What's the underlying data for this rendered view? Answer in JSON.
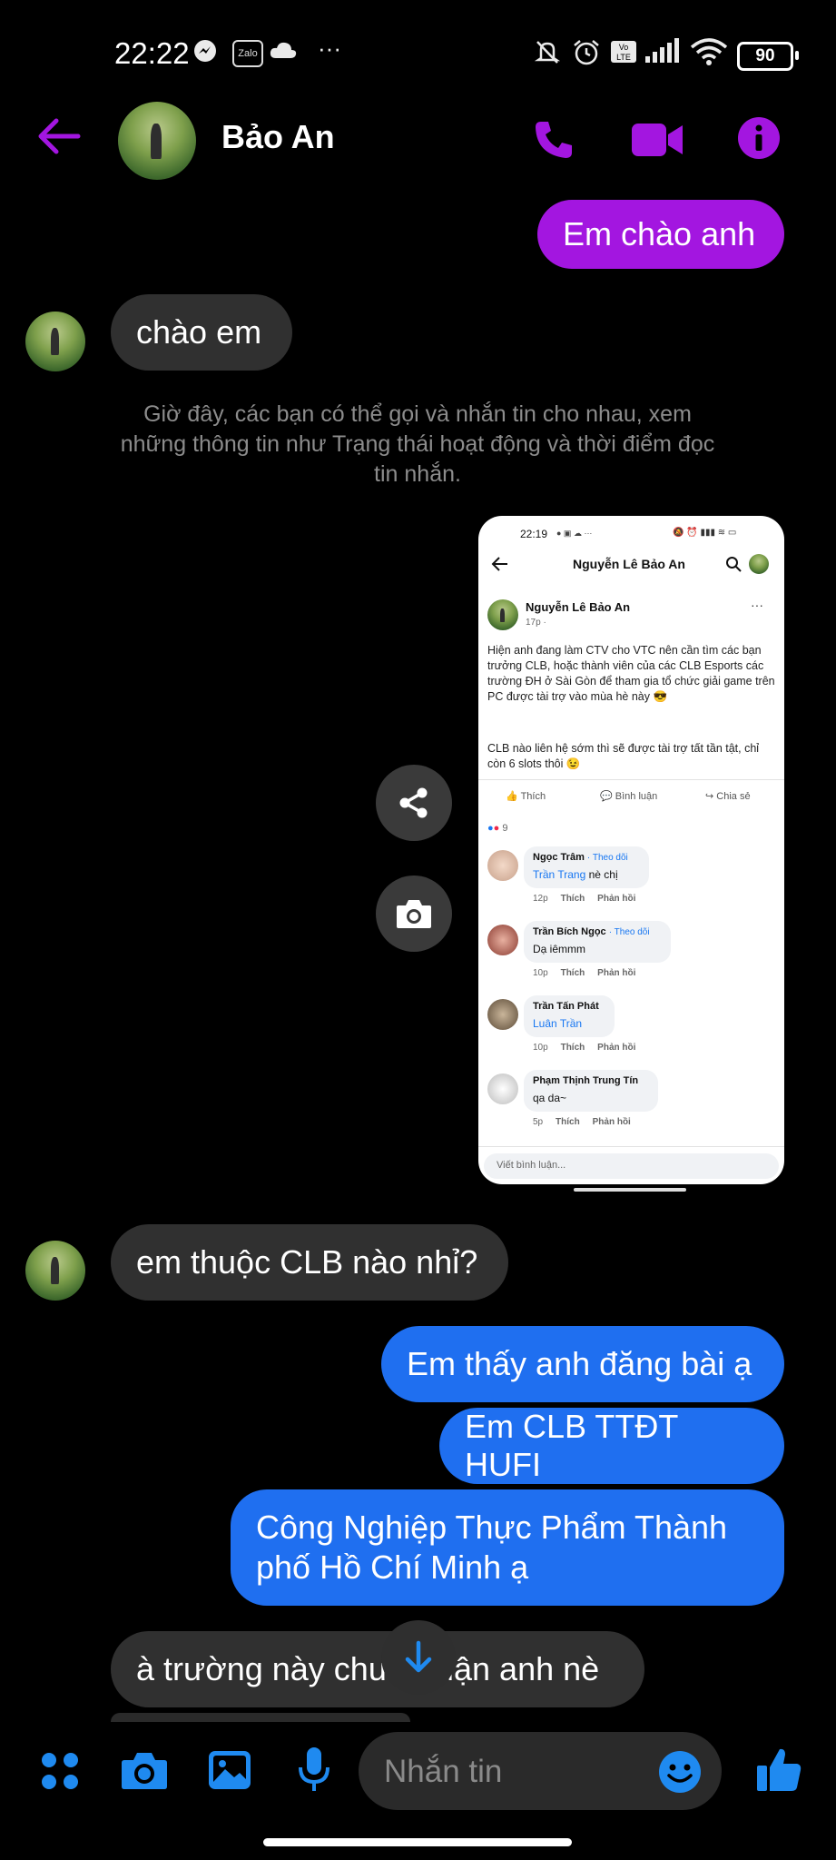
{
  "status_bar": {
    "time": "22:22",
    "zalo_label": "Zalo",
    "battery": "90",
    "more": "···"
  },
  "header": {
    "contact_name": "Bảo An"
  },
  "messages": {
    "m1": "Em chào anh",
    "m2": "chào em",
    "system": "Giờ đây, các bạn có thể gọi và nhắn tin cho nhau, xem những thông tin như Trạng thái hoạt động và thời điểm đọc tin nhắn.",
    "m3": "em thuộc CLB nào nhỉ?",
    "m4": "Em thấy anh đăng bài ạ",
    "m5": "Em CLB TTĐT HUFI",
    "m6": "Công Nghiệp Thực Phẩm Thành phố Hồ Chí Minh ạ",
    "m7": "à trường này chưa quận anh nè"
  },
  "shared_screenshot": {
    "time": "22:19",
    "title": "Nguyễn Lê Bảo An",
    "author": "Nguyễn Lê Bảo An",
    "post_meta": "17p ·",
    "post_text_1": "Hiện anh đang làm CTV cho VTC nên cần tìm các bạn trưởng CLB, hoặc thành viên của các CLB Esports các trường ĐH ở Sài Gòn để tham gia tổ chức giải game trên PC được tài trợ vào mùa hè này 😎",
    "post_text_2": "CLB nào liên hệ sớm thì sẽ được tài trợ tất tần tật, chỉ còn 6 slots thôi 😉",
    "like": "Thích",
    "comment": "Bình luận",
    "share": "Chia sẻ",
    "reaction_count": "9",
    "comments": [
      {
        "name": "Ngọc Trâm",
        "follow": "· Theo dõi",
        "tag": "Trần Trang",
        "text": " nè chị",
        "time": "12p",
        "like": "Thích",
        "reply": "Phản hồi"
      },
      {
        "name": "Trần Bích Ngọc",
        "follow": "· Theo dõi",
        "tag": "",
        "text": "Dạ iêmmm",
        "time": "10p",
        "like": "Thích",
        "reply": "Phản hồi"
      },
      {
        "name": "Trần Tấn Phát",
        "follow": "",
        "tag": "Luân Trần",
        "text": "",
        "time": "10p",
        "like": "Thích",
        "reply": "Phản hồi"
      },
      {
        "name": "Phạm Thịnh Trung Tín",
        "follow": "",
        "tag": "",
        "text": "qa da~",
        "time": "5p",
        "like": "Thích",
        "reply": "Phản hồi"
      }
    ],
    "comment_placeholder": "Viết bình luận..."
  },
  "composer": {
    "placeholder": "Nhắn tin"
  },
  "colors": {
    "accent_purple": "#a316e0",
    "blue_bubble": "#1f6ff0",
    "icon_blue": "#1f8af0",
    "gray_bubble": "#303030"
  }
}
